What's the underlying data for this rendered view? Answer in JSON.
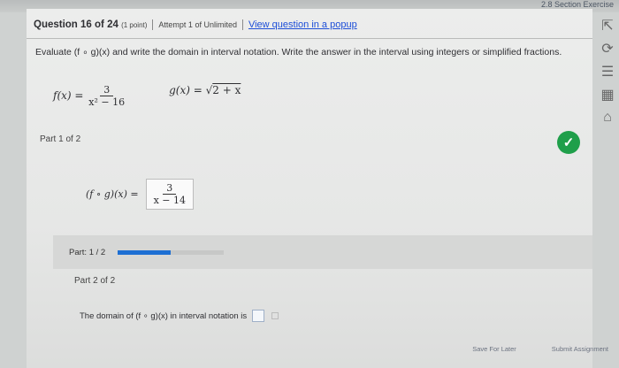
{
  "section_tag": "2.8 Section Exercise",
  "question": {
    "title": "Question 16 of 24",
    "points": "(1 point)",
    "attempt": "Attempt 1 of Unlimited",
    "popup_link": "View question in a popup"
  },
  "instructions": "Evaluate (f ∘ g)(x) and write the domain in interval notation. Write the answer in the interval using integers or simplified fractions.",
  "formulas": {
    "f_label": "f(x) =",
    "f_numerator": "3",
    "f_denominator": "x² − 16",
    "g_label": "g(x) =",
    "g_radicand": "2 + x"
  },
  "part1": {
    "label": "Part 1 of 2",
    "answer_lhs": "(f ∘ g)(x) =",
    "answer_numerator": "3",
    "answer_denominator": "x − 14",
    "status": "correct"
  },
  "progress": {
    "label": "Part: 1 / 2",
    "fraction": 0.5
  },
  "part2": {
    "label": "Part 2 of 2",
    "domain_prompt": "The domain of (f ∘ g)(x) in interval notation is"
  },
  "footer": {
    "save_label": "Save For Later",
    "submit_label": "Submit Assignment"
  },
  "colors": {
    "accent_blue": "#1d6fd3",
    "check_green": "#1f9f4a"
  }
}
